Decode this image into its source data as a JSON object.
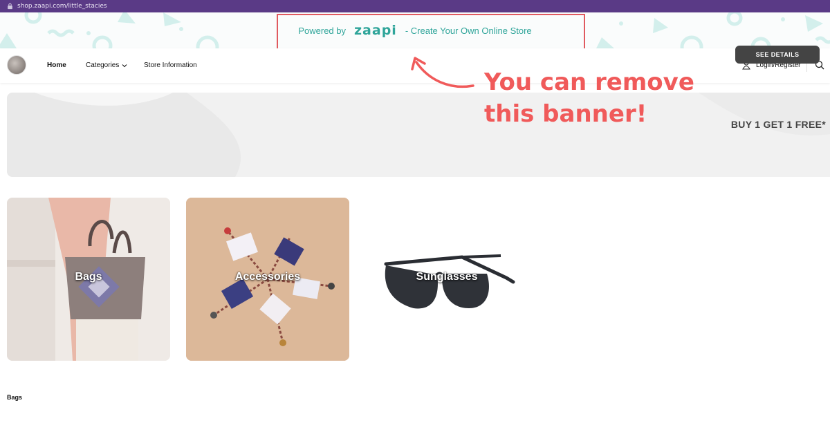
{
  "browser": {
    "url": "shop.zaapi.com/little_stacies"
  },
  "powered_banner": {
    "prefix": "Powered by",
    "brand": "zaapi",
    "suffix": "- Create Your Own Online Store",
    "color": "#2fa59a"
  },
  "nav": {
    "home": "Home",
    "categories": "Categories",
    "store_info": "Store Information",
    "login": "Login/Register"
  },
  "annotation": {
    "line1": "You can remove",
    "line2": "this banner!",
    "color": "#f05a5a"
  },
  "promo": {
    "headline": "BUY 1 GET 1 FREE*",
    "button": "SEE DETAILS"
  },
  "categories": [
    {
      "label": "Bags"
    },
    {
      "label": "Accessories"
    },
    {
      "label": "Sunglasses"
    }
  ],
  "section": {
    "title": "Bags"
  },
  "icons": {
    "lock": "lock-icon",
    "chevron": "chevron-down-icon",
    "user": "user-icon",
    "search": "search-icon"
  }
}
